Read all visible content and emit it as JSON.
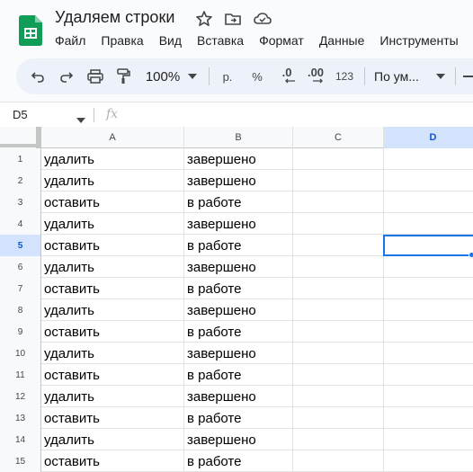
{
  "document": {
    "title": "Удаляем строки",
    "icons": [
      "star-icon",
      "move-to-folder-icon",
      "cloud-saved-icon"
    ]
  },
  "menu": [
    "Файл",
    "Правка",
    "Вид",
    "Вставка",
    "Формат",
    "Данные",
    "Инструменты"
  ],
  "toolbar": {
    "zoom": "100%",
    "currency": "р.",
    "percent": "%",
    "decrease_decimals": ".0",
    "increase_decimals": ".00",
    "number_format": "123",
    "font_selector": "По ум..."
  },
  "formula_bar": {
    "name_box": "D5",
    "fx_label": "fx",
    "value": ""
  },
  "grid": {
    "columns": [
      "A",
      "B",
      "C",
      "D"
    ],
    "active_column": "D",
    "active_row": "5",
    "rows": [
      {
        "num": "1",
        "a": "удалить",
        "b": "завершено"
      },
      {
        "num": "2",
        "a": "удалить",
        "b": "завершено"
      },
      {
        "num": "3",
        "a": "оставить",
        "b": "в работе"
      },
      {
        "num": "4",
        "a": "удалить",
        "b": "завершено"
      },
      {
        "num": "5",
        "a": "оставить",
        "b": "в работе"
      },
      {
        "num": "6",
        "a": "удалить",
        "b": "завершено"
      },
      {
        "num": "7",
        "a": "оставить",
        "b": "в работе"
      },
      {
        "num": "8",
        "a": "удалить",
        "b": "завершено"
      },
      {
        "num": "9",
        "a": "оставить",
        "b": "в работе"
      },
      {
        "num": "10",
        "a": "удалить",
        "b": "завершено"
      },
      {
        "num": "11",
        "a": "оставить",
        "b": "в работе"
      },
      {
        "num": "12",
        "a": "удалить",
        "b": "завершено"
      },
      {
        "num": "13",
        "a": "оставить",
        "b": "в работе"
      },
      {
        "num": "14",
        "a": "удалить",
        "b": "завершено"
      },
      {
        "num": "15",
        "a": "оставить",
        "b": "в работе"
      }
    ]
  },
  "colors": {
    "accent": "#1a73e8",
    "header_active": "#d3e3fd",
    "sheets_green": "#0f9d58"
  }
}
